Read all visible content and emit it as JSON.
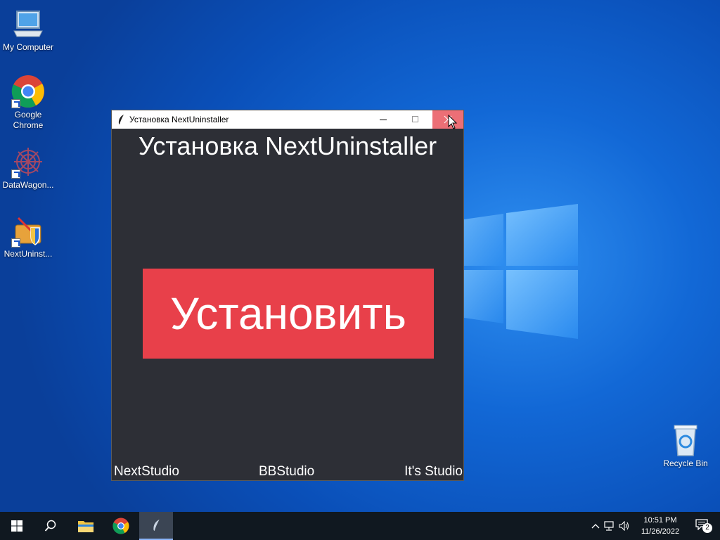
{
  "desktop": {
    "icons": [
      {
        "label": "My Computer"
      },
      {
        "label": "Google Chrome"
      },
      {
        "label": "DataWagon..."
      },
      {
        "label": "NextUninst..."
      },
      {
        "label": "Recycle Bin"
      }
    ]
  },
  "window": {
    "title": "Установка NextUninstaller",
    "heading": "Установка NextUninstaller",
    "install_button": "Установить",
    "footer": [
      "NextStudio",
      "BBStudio",
      "It's Studio"
    ],
    "colors": {
      "background": "#2d2f36",
      "button": "#e8404a",
      "close_hover": "#ec6f76"
    }
  },
  "taskbar": {
    "clock_time": "10:51 PM",
    "clock_date": "11/26/2022",
    "notification_count": "2"
  }
}
